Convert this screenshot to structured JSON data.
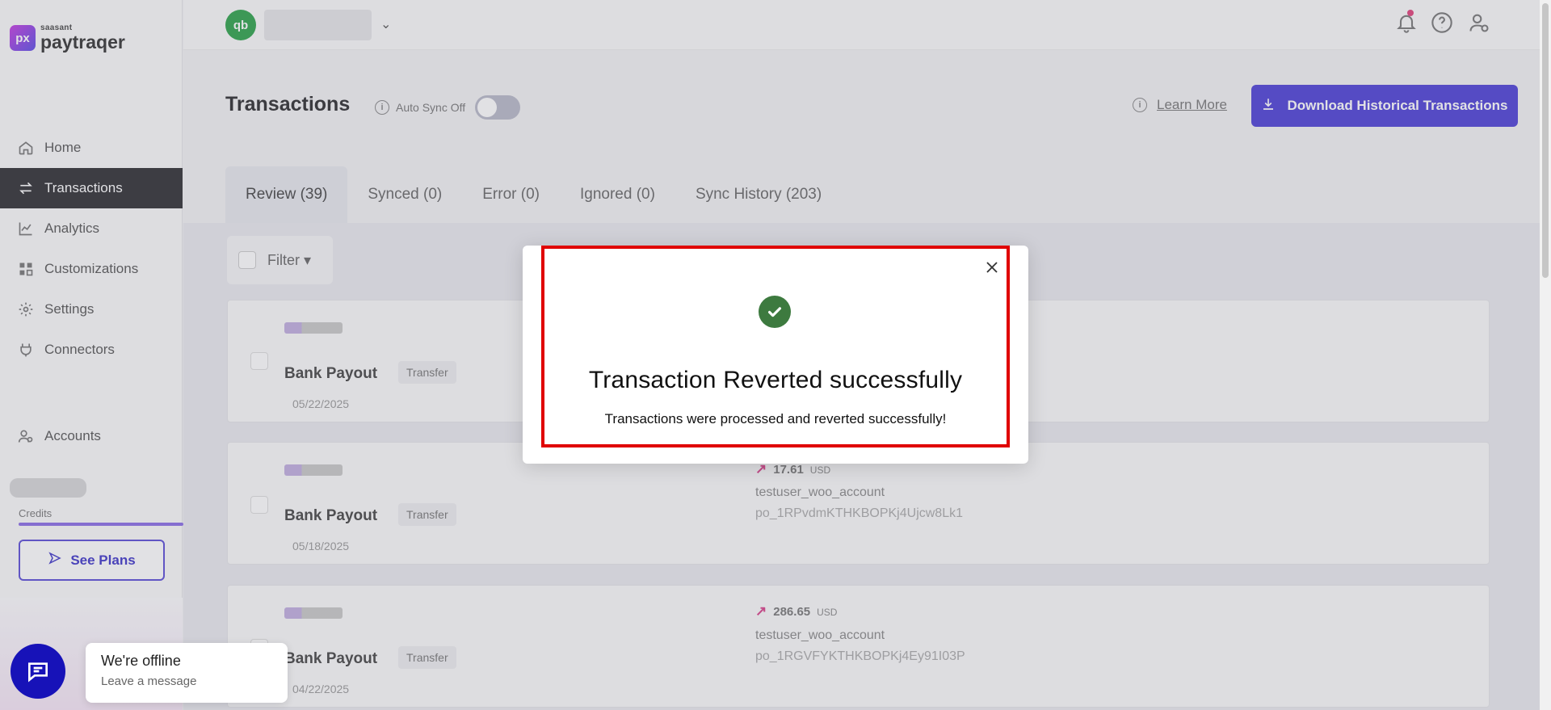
{
  "app": {
    "logo_small": "saasant",
    "logo_big": "paytraqer"
  },
  "sidebar": {
    "items": [
      {
        "label": "Home",
        "icon": "home-icon"
      },
      {
        "label": "Transactions",
        "icon": "transfer-icon",
        "active": true
      },
      {
        "label": "Analytics",
        "icon": "chart-icon"
      },
      {
        "label": "Customizations",
        "icon": "grid-icon"
      },
      {
        "label": "Settings",
        "icon": "gear-icon"
      },
      {
        "label": "Connectors",
        "icon": "plug-icon"
      }
    ],
    "accounts_label": "Accounts",
    "credits_label": "Credits",
    "see_plans_label": "See Plans"
  },
  "header": {
    "title": "Transactions",
    "auto_sync_label": "Auto Sync Off",
    "learn_more_label": "Learn More",
    "download_label": "Download Historical Transactions"
  },
  "tabs": [
    {
      "label": "Review (39)",
      "active": true
    },
    {
      "label": "Synced (0)"
    },
    {
      "label": "Error (0)"
    },
    {
      "label": "Ignored (0)"
    },
    {
      "label": "Sync History (203)"
    }
  ],
  "filter_label": "Filter",
  "rows": [
    {
      "title": "Bank Payout",
      "type": "Transfer",
      "date": "05/22/2025",
      "amount": "",
      "currency": "",
      "account": "",
      "payout_id": ""
    },
    {
      "title": "Bank Payout",
      "type": "Transfer",
      "date": "05/18/2025",
      "amount": "17.61",
      "currency": "USD",
      "account": "testuser_woo_account",
      "payout_id": "po_1RPvdmKTHKBOPKj4Ujcw8Lk1"
    },
    {
      "title": "Bank Payout",
      "type": "Transfer",
      "date": "04/22/2025",
      "amount": "286.65",
      "currency": "USD",
      "account": "testuser_woo_account",
      "payout_id": "po_1RGVFYKTHKBOPKj4Ey91I03P"
    }
  ],
  "modal": {
    "title": "Transaction Reverted successfully",
    "message": "Transactions were processed and reverted successfully!",
    "icon": "check-circle-icon",
    "highlight_color": "#e00000",
    "success_color": "#3d7a3f"
  },
  "chat": {
    "title": "We're offline",
    "subtitle": "Leave a message"
  },
  "colors": {
    "accent": "#4c3fd6",
    "sidebar_active": "#2d2d31"
  }
}
